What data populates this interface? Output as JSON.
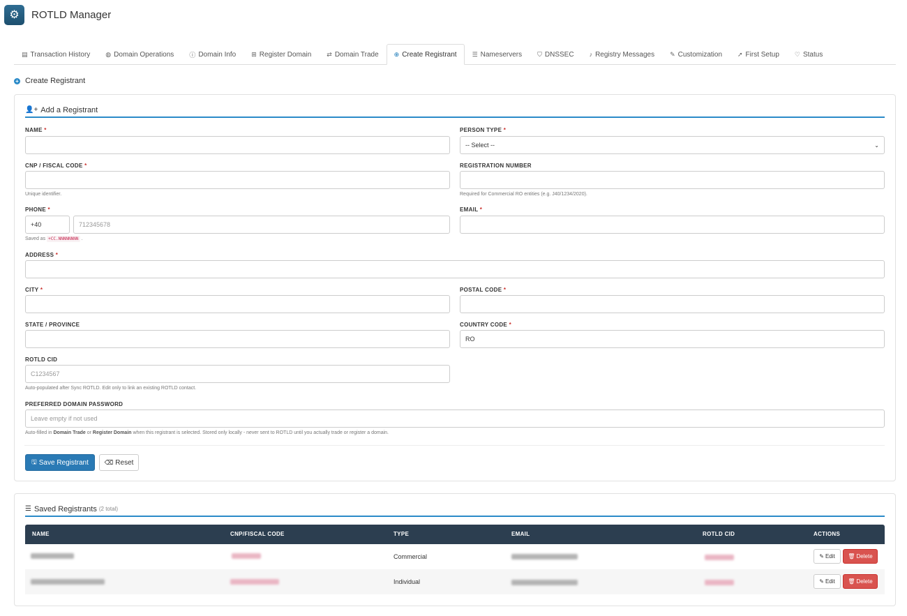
{
  "app": {
    "title": "ROTLD Manager",
    "logo_icon": "gear-icon"
  },
  "tabs": [
    {
      "label": "Transaction History",
      "icon": "list-alt-icon"
    },
    {
      "label": "Domain Operations",
      "icon": "globe-icon"
    },
    {
      "label": "Domain Info",
      "icon": "info-circle-icon"
    },
    {
      "label": "Register Domain",
      "icon": "plus-square-icon"
    },
    {
      "label": "Domain Trade",
      "icon": "exchange-icon"
    },
    {
      "label": "Create Registrant",
      "icon": "plus-circle-icon",
      "active": true
    },
    {
      "label": "Nameservers",
      "icon": "server-icon"
    },
    {
      "label": "DNSSEC",
      "icon": "shield-icon"
    },
    {
      "label": "Registry Messages",
      "icon": "bell-icon"
    },
    {
      "label": "Customization",
      "icon": "paint-brush-icon"
    },
    {
      "label": "First Setup",
      "icon": "rocket-icon"
    },
    {
      "label": "Status",
      "icon": "heartbeat-icon"
    }
  ],
  "page": {
    "title": "Create Registrant"
  },
  "form": {
    "heading": "Add a Registrant",
    "name": {
      "label": "NAME",
      "value": ""
    },
    "person_type": {
      "label": "PERSON TYPE",
      "value": "-- Select --"
    },
    "cnp": {
      "label": "CNP / FISCAL CODE",
      "value": "",
      "help": "Unique identifier."
    },
    "reg_number": {
      "label": "REGISTRATION NUMBER",
      "value": "",
      "help": "Required for Commercial RO entities (e.g. J40/1234/2020)."
    },
    "phone": {
      "label": "PHONE",
      "prefix": "+40",
      "placeholder": "712345678",
      "help_pre": "Saved as",
      "help_code": "+CC.NNNNNNNN",
      "help_post": "."
    },
    "email": {
      "label": "EMAIL",
      "value": ""
    },
    "address": {
      "label": "ADDRESS",
      "value": ""
    },
    "city": {
      "label": "CITY",
      "value": ""
    },
    "postal": {
      "label": "POSTAL CODE",
      "value": ""
    },
    "state": {
      "label": "STATE / PROVINCE",
      "value": ""
    },
    "country": {
      "label": "COUNTRY CODE",
      "value": "RO"
    },
    "cid": {
      "label": "ROTLD CID",
      "placeholder": "C1234567",
      "help": "Auto-populated after Sync ROTLD. Edit only to link an existing ROTLD contact."
    },
    "password": {
      "label": "PREFERRED DOMAIN PASSWORD",
      "placeholder": "Leave empty if not used",
      "help_1": "Auto-filled in",
      "help_b1": "Domain Trade",
      "help_2": "or",
      "help_b2": "Register Domain",
      "help_3": "when this registrant is selected. Stored only locally - never sent to ROTLD until you actually trade or register a domain."
    },
    "save_label": "Save Registrant",
    "reset_label": "Reset",
    "required_mark": "*"
  },
  "saved": {
    "heading": "Saved Registrants",
    "count": "(2 total)",
    "columns": [
      "NAME",
      "CNP/FISCAL CODE",
      "TYPE",
      "EMAIL",
      "ROTLD CID",
      "ACTIONS"
    ],
    "rows": [
      {
        "type": "Commercial"
      },
      {
        "type": "Individual"
      }
    ],
    "edit_label": "Edit",
    "delete_label": "Delete"
  },
  "colors": {
    "accent": "#2a8ac8",
    "primary_button": "#2a7ab5",
    "table_header": "#2c3e50",
    "danger": "#d9534f"
  }
}
